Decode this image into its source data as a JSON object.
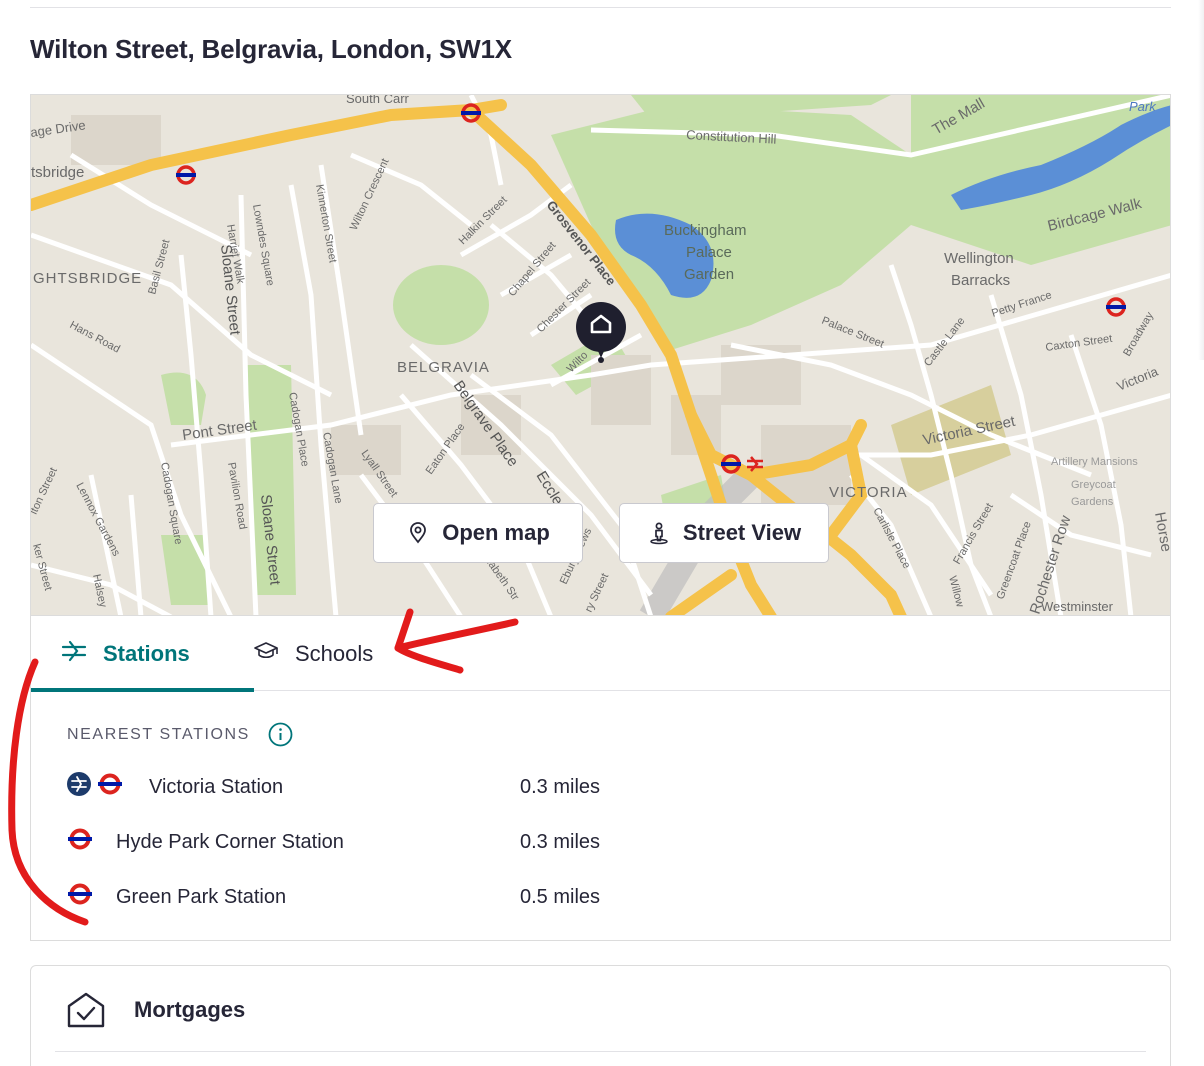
{
  "address": "Wilton Street, Belgravia, London, SW1X",
  "map": {
    "buttons": {
      "open_map": "Open map",
      "street_view": "Street View"
    },
    "labels": {
      "south_carriage": "South Carr",
      "carriage_drive": "age Drive",
      "knightsbridge_road": "tsbridge",
      "knightsbridge_area": "GHTSBRIDGE",
      "constitution_hill": "Constitution Hill",
      "the_mall": "The Mall",
      "park": "Park",
      "buckingham": "Buckingham",
      "palace": "Palace",
      "garden": "Garden",
      "birdcage_walk": "Birdcage Walk",
      "wellington": "Wellington",
      "barracks": "Barracks",
      "petty_france": "Petty France",
      "caxton_street": "Caxton Street",
      "broadway": "Broadway",
      "victoria_road": "Victoria",
      "victoria_street": "Victoria Street",
      "belgravia": "BELGRAVIA",
      "victoria_area": "VICTORIA",
      "grosvenor_place": "Grosvenor Place",
      "halkin_street": "Halkin Street",
      "chapel_street": "Chapel Street",
      "chester_street": "Chester Street",
      "wilton": "Wilto",
      "wilton_crescent": "Wilton Crescent",
      "kinnerton_street": "Kinnerton Street",
      "lowndes_square": "Lowndes Square",
      "harriet_walk": "Harriet Walk",
      "sloane_street": "Sloane Street",
      "basil_street": "Basil Street",
      "hans_road": "Hans Road",
      "pont_street": "Pont Street",
      "cadogan_place": "Cadogan Place",
      "cadogan_lane": "Cadogan Lane",
      "cadogan_square": "Cadogan Square",
      "pavilion_road": "Pavilion Road",
      "lyall_street": "Lyall Street",
      "eaton_place": "Eaton Place",
      "belgrave_place": "Belgrave Place",
      "eccleston": "Eccles",
      "square": "uare",
      "elizabeth_street": "Elizabeth Str",
      "ebury_mews": "Ebury Mews",
      "palace_street": "Palace Street",
      "castle_lane": "Castle Lane",
      "carlisle_place": "Carlisle Place",
      "francis_street": "Francis Street",
      "greencoat_place": "Greencoat Place",
      "rochester_row": "Rochester Row",
      "artillery_mansions": "Artillery Mansions",
      "greycoat": "Greycoat",
      "gardens": "Gardens",
      "westminster": "Westminster",
      "horse": "Horse",
      "lennox_gardens": "Lennox Gardens",
      "halsey": "Halsey",
      "walton_street": "lton Street",
      "street_partial": "ker Street",
      "willow": "Willow",
      "street_frag": "ry Street"
    }
  },
  "tabs": {
    "stations": "Stations",
    "schools": "Schools"
  },
  "nearest": {
    "heading": "NEAREST STATIONS",
    "stations": [
      {
        "name": "Victoria Station",
        "distance": "0.3 miles",
        "rail": true,
        "underground": true
      },
      {
        "name": "Hyde Park Corner Station",
        "distance": "0.3 miles",
        "rail": false,
        "underground": true
      },
      {
        "name": "Green Park Station",
        "distance": "0.5 miles",
        "rail": false,
        "underground": true
      }
    ]
  },
  "mortgages": {
    "label": "Mortgages"
  },
  "colors": {
    "accent": "#00757a",
    "text": "#262637",
    "annotation": "#e21b1b",
    "underground_red": "#dc241f",
    "underground_blue": "#0019a8",
    "rail_navy": "#1d3b6b"
  }
}
